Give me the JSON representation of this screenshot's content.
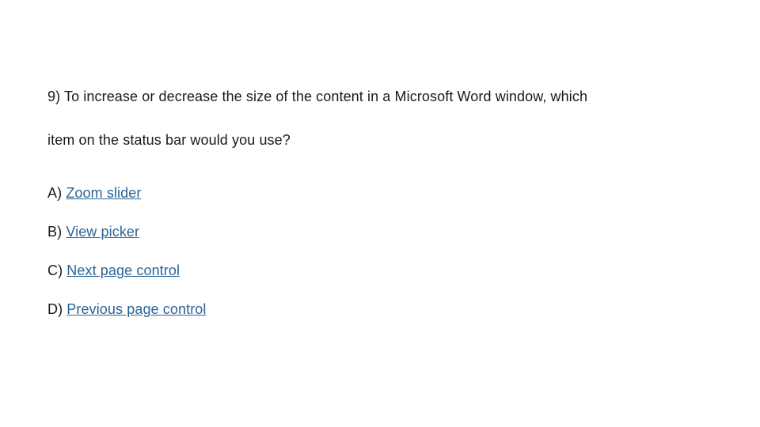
{
  "question": {
    "line1": "9) To increase or decrease the size of the content in a Microsoft Word window, which",
    "line2": "item on the status bar would you use?"
  },
  "choices": {
    "a": {
      "prefix": "A) ",
      "text": "Zoom slider"
    },
    "b": {
      "prefix": "B) ",
      "text": "View picker"
    },
    "c": {
      "prefix": "C) ",
      "text": "Next page control"
    },
    "d": {
      "prefix": "D) ",
      "text": "Previous page control"
    }
  }
}
